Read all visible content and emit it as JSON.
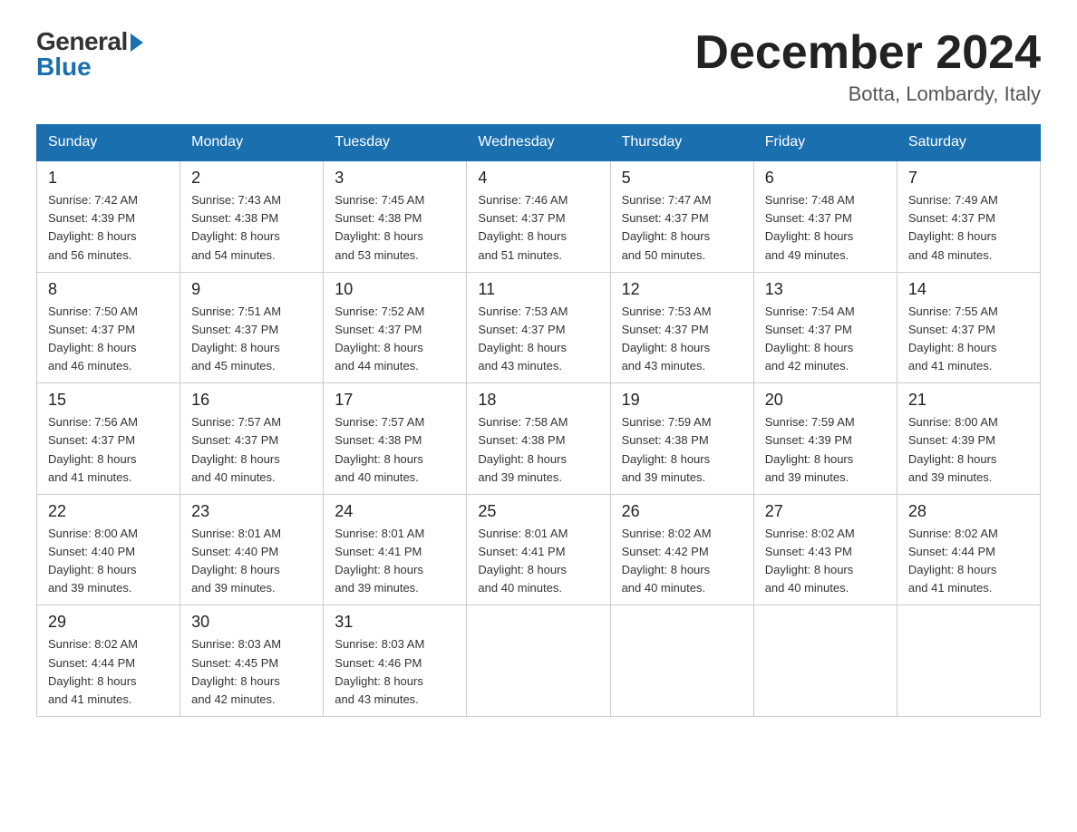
{
  "logo": {
    "general": "General",
    "blue": "Blue"
  },
  "title": "December 2024",
  "location": "Botta, Lombardy, Italy",
  "days_of_week": [
    "Sunday",
    "Monday",
    "Tuesday",
    "Wednesday",
    "Thursday",
    "Friday",
    "Saturday"
  ],
  "weeks": [
    [
      {
        "day": "1",
        "info": "Sunrise: 7:42 AM\nSunset: 4:39 PM\nDaylight: 8 hours\nand 56 minutes."
      },
      {
        "day": "2",
        "info": "Sunrise: 7:43 AM\nSunset: 4:38 PM\nDaylight: 8 hours\nand 54 minutes."
      },
      {
        "day": "3",
        "info": "Sunrise: 7:45 AM\nSunset: 4:38 PM\nDaylight: 8 hours\nand 53 minutes."
      },
      {
        "day": "4",
        "info": "Sunrise: 7:46 AM\nSunset: 4:37 PM\nDaylight: 8 hours\nand 51 minutes."
      },
      {
        "day": "5",
        "info": "Sunrise: 7:47 AM\nSunset: 4:37 PM\nDaylight: 8 hours\nand 50 minutes."
      },
      {
        "day": "6",
        "info": "Sunrise: 7:48 AM\nSunset: 4:37 PM\nDaylight: 8 hours\nand 49 minutes."
      },
      {
        "day": "7",
        "info": "Sunrise: 7:49 AM\nSunset: 4:37 PM\nDaylight: 8 hours\nand 48 minutes."
      }
    ],
    [
      {
        "day": "8",
        "info": "Sunrise: 7:50 AM\nSunset: 4:37 PM\nDaylight: 8 hours\nand 46 minutes."
      },
      {
        "day": "9",
        "info": "Sunrise: 7:51 AM\nSunset: 4:37 PM\nDaylight: 8 hours\nand 45 minutes."
      },
      {
        "day": "10",
        "info": "Sunrise: 7:52 AM\nSunset: 4:37 PM\nDaylight: 8 hours\nand 44 minutes."
      },
      {
        "day": "11",
        "info": "Sunrise: 7:53 AM\nSunset: 4:37 PM\nDaylight: 8 hours\nand 43 minutes."
      },
      {
        "day": "12",
        "info": "Sunrise: 7:53 AM\nSunset: 4:37 PM\nDaylight: 8 hours\nand 43 minutes."
      },
      {
        "day": "13",
        "info": "Sunrise: 7:54 AM\nSunset: 4:37 PM\nDaylight: 8 hours\nand 42 minutes."
      },
      {
        "day": "14",
        "info": "Sunrise: 7:55 AM\nSunset: 4:37 PM\nDaylight: 8 hours\nand 41 minutes."
      }
    ],
    [
      {
        "day": "15",
        "info": "Sunrise: 7:56 AM\nSunset: 4:37 PM\nDaylight: 8 hours\nand 41 minutes."
      },
      {
        "day": "16",
        "info": "Sunrise: 7:57 AM\nSunset: 4:37 PM\nDaylight: 8 hours\nand 40 minutes."
      },
      {
        "day": "17",
        "info": "Sunrise: 7:57 AM\nSunset: 4:38 PM\nDaylight: 8 hours\nand 40 minutes."
      },
      {
        "day": "18",
        "info": "Sunrise: 7:58 AM\nSunset: 4:38 PM\nDaylight: 8 hours\nand 39 minutes."
      },
      {
        "day": "19",
        "info": "Sunrise: 7:59 AM\nSunset: 4:38 PM\nDaylight: 8 hours\nand 39 minutes."
      },
      {
        "day": "20",
        "info": "Sunrise: 7:59 AM\nSunset: 4:39 PM\nDaylight: 8 hours\nand 39 minutes."
      },
      {
        "day": "21",
        "info": "Sunrise: 8:00 AM\nSunset: 4:39 PM\nDaylight: 8 hours\nand 39 minutes."
      }
    ],
    [
      {
        "day": "22",
        "info": "Sunrise: 8:00 AM\nSunset: 4:40 PM\nDaylight: 8 hours\nand 39 minutes."
      },
      {
        "day": "23",
        "info": "Sunrise: 8:01 AM\nSunset: 4:40 PM\nDaylight: 8 hours\nand 39 minutes."
      },
      {
        "day": "24",
        "info": "Sunrise: 8:01 AM\nSunset: 4:41 PM\nDaylight: 8 hours\nand 39 minutes."
      },
      {
        "day": "25",
        "info": "Sunrise: 8:01 AM\nSunset: 4:41 PM\nDaylight: 8 hours\nand 40 minutes."
      },
      {
        "day": "26",
        "info": "Sunrise: 8:02 AM\nSunset: 4:42 PM\nDaylight: 8 hours\nand 40 minutes."
      },
      {
        "day": "27",
        "info": "Sunrise: 8:02 AM\nSunset: 4:43 PM\nDaylight: 8 hours\nand 40 minutes."
      },
      {
        "day": "28",
        "info": "Sunrise: 8:02 AM\nSunset: 4:44 PM\nDaylight: 8 hours\nand 41 minutes."
      }
    ],
    [
      {
        "day": "29",
        "info": "Sunrise: 8:02 AM\nSunset: 4:44 PM\nDaylight: 8 hours\nand 41 minutes."
      },
      {
        "day": "30",
        "info": "Sunrise: 8:03 AM\nSunset: 4:45 PM\nDaylight: 8 hours\nand 42 minutes."
      },
      {
        "day": "31",
        "info": "Sunrise: 8:03 AM\nSunset: 4:46 PM\nDaylight: 8 hours\nand 43 minutes."
      },
      null,
      null,
      null,
      null
    ]
  ]
}
